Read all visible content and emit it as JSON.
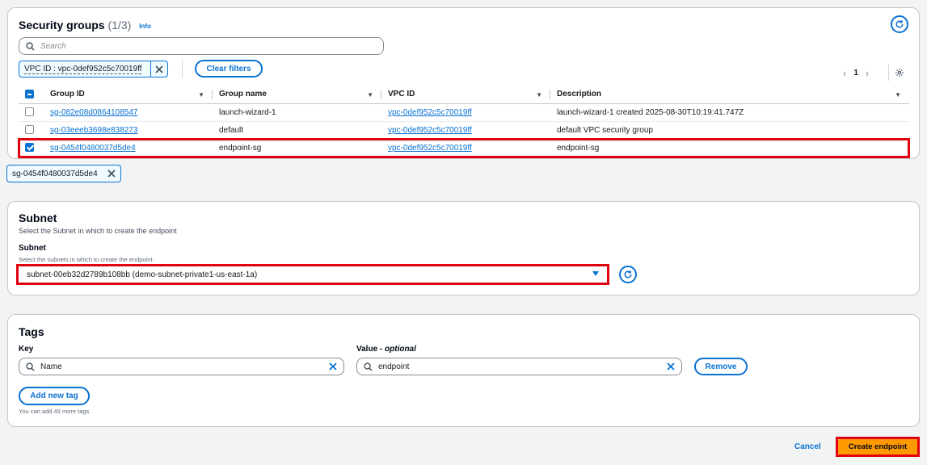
{
  "security_groups": {
    "title": "Security groups",
    "count": "(1/3)",
    "info": "Info",
    "search_placeholder": "Search",
    "filter_token": "VPC ID : vpc-0def952c5c70019ff",
    "clear_filters": "Clear filters",
    "page": "1",
    "columns": [
      "Group ID",
      "Group name",
      "VPC ID",
      "Description"
    ],
    "rows": [
      {
        "group_id": "sg-082e08d0864108547",
        "group_name": "launch-wizard-1",
        "vpc_id": "vpc-0def952c5c70019ff",
        "description": "launch-wizard-1 created 2025-08-30T10:19:41.747Z",
        "selected": false
      },
      {
        "group_id": "sg-03eeeb3698e838273",
        "group_name": "default",
        "vpc_id": "vpc-0def952c5c70019ff",
        "description": "default VPC security group",
        "selected": false
      },
      {
        "group_id": "sg-0454f0480037d5de4",
        "group_name": "endpoint-sg",
        "vpc_id": "vpc-0def952c5c70019ff",
        "description": "endpoint-sg",
        "selected": true
      }
    ],
    "selected_token": "sg-0454f0480037d5de4"
  },
  "subnet": {
    "title": "Subnet",
    "description": "Select the Subnet in which to create the endpoint",
    "field_label": "Subnet",
    "field_hint": "Select the subnets in which to create the endpoint.",
    "selected_value": "subnet-00eb32d2789b108bb (demo-subnet-private1-us-east-1a)"
  },
  "tags": {
    "title": "Tags",
    "key_label": "Key",
    "value_label": "Value - ",
    "value_label_optional": "optional",
    "key_value": "Name",
    "value_value": "endpoint",
    "remove": "Remove",
    "add_new_tag": "Add new tag",
    "hint": "You can add 49 more tags."
  },
  "footer": {
    "cancel": "Cancel",
    "create": "Create endpoint"
  },
  "colors": {
    "accent": "#0972d3",
    "highlight": "#e0000f",
    "primary": "#ff9900"
  }
}
